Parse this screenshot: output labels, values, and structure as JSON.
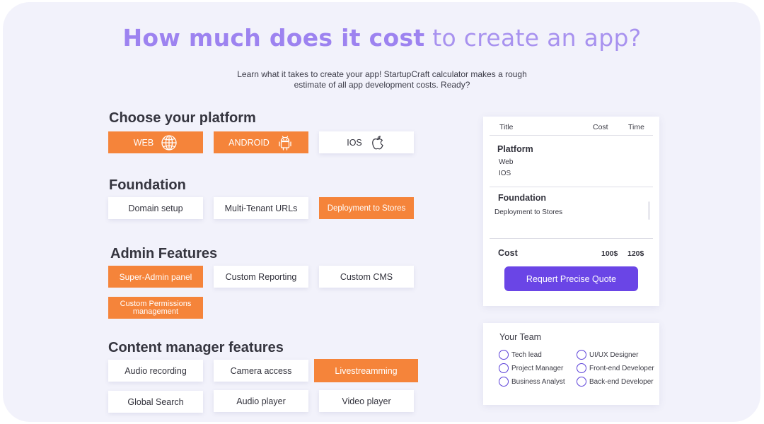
{
  "headline": {
    "strong": "How much does it cost",
    "light": " to create an app?"
  },
  "intro": {
    "line1": "Learn what it takes to create your app! StartupCraft calculator makes a rough",
    "line2": "estimate of all app development costs. Ready?"
  },
  "colors": {
    "accent_orange": "#f5843a",
    "accent_purple": "#6a45e6",
    "headline_purple": "#9d83f0",
    "background": "#f2f2fb"
  },
  "sections": {
    "platform": {
      "title": "Choose your platform",
      "options": [
        {
          "label": "WEB",
          "icon": "globe-icon",
          "selected": true
        },
        {
          "label": "ANDROID",
          "icon": "android-icon",
          "selected": true
        },
        {
          "label": "IOS",
          "icon": "apple-icon",
          "selected": false
        }
      ]
    },
    "foundation": {
      "title": "Foundation",
      "options": [
        {
          "label": "Domain setup",
          "selected": false
        },
        {
          "label": "Multi-Tenant URLs",
          "selected": false
        },
        {
          "label": "Deployment to Stores",
          "selected": true
        }
      ]
    },
    "admin": {
      "title": "Admin Features",
      "options": [
        {
          "label": "Super-Admin panel",
          "selected": true
        },
        {
          "label": "Custom Reporting",
          "selected": false
        },
        {
          "label": "Custom CMS",
          "selected": false
        },
        {
          "label": "Custom Permissions management",
          "selected": true
        }
      ]
    },
    "content": {
      "title": "Content manager features",
      "options": [
        {
          "label": "Audio recording",
          "selected": false
        },
        {
          "label": "Camera access",
          "selected": false
        },
        {
          "label": "Livestreamming",
          "selected": true
        },
        {
          "label": "Global Search",
          "selected": false
        },
        {
          "label": "Audio player",
          "selected": false
        },
        {
          "label": "Video player",
          "selected": false
        }
      ]
    }
  },
  "summary": {
    "headers": {
      "title": "Title",
      "cost": "Cost",
      "time": "Time"
    },
    "platform": {
      "label": "Platform",
      "items": [
        "Web",
        "IOS"
      ]
    },
    "foundation": {
      "label": "Foundation",
      "items": [
        "Deployment to Stores"
      ]
    },
    "total": {
      "label": "Cost",
      "cost": "100$",
      "time": "120$"
    },
    "quote_button": "Requert Precise Quote"
  },
  "team": {
    "title": "Your Team",
    "members": [
      "Tech lead",
      "UI/UX Designer",
      "Project Manager",
      "Front-end Developer",
      "Business Analyst",
      "Back-end Developer"
    ]
  }
}
